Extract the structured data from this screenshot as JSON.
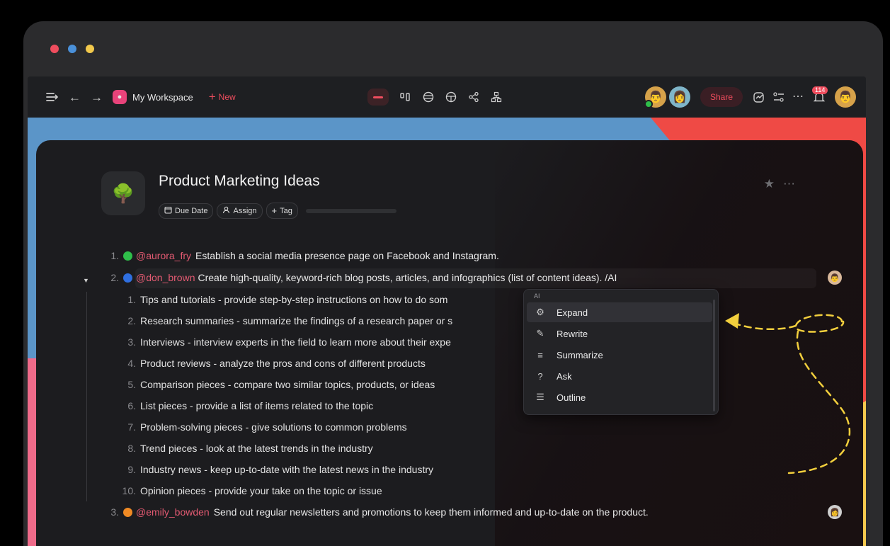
{
  "window": {
    "dot_colors": [
      "#ef4d5e",
      "#4a90d9",
      "#f2c94c"
    ]
  },
  "toolbar": {
    "workspace_name": "My Workspace",
    "new_label": "New",
    "share_label": "Share",
    "notification_count": "114",
    "accent": "#ef4d5e"
  },
  "document": {
    "title": "Product Marketing Ideas",
    "chips": [
      "Due Date",
      "Assign",
      "Tag"
    ],
    "items": [
      {
        "num": "1.",
        "mention": "@aurora_fry",
        "dot_color": "#2fbf4a",
        "text": "Establish a social media presence page on Facebook and Instagram."
      },
      {
        "num": "2.",
        "mention": "@don_brown",
        "dot_color": "#2f6fe0",
        "text": "Create high-quality, keyword-rich blog posts, articles, and infographics (list of content ideas). /AI"
      },
      {
        "num": "3.",
        "mention": "@emily_bowden",
        "dot_color": "#f08a24",
        "text": "Send out regular newsletters and promotions to keep them informed and up-to-date on the product."
      }
    ],
    "sub_items": [
      {
        "num": "1.",
        "text": "Tips and tutorials - provide step-by-step instructions on how to do som"
      },
      {
        "num": "2.",
        "text": "Research summaries - summarize the findings of a research paper or s"
      },
      {
        "num": "3.",
        "text": "Interviews - interview experts in the field to learn more about their expe"
      },
      {
        "num": "4.",
        "text": "Product reviews - analyze the pros and cons of different products"
      },
      {
        "num": "5.",
        "text": "Comparison pieces - compare two similar topics, products, or ideas"
      },
      {
        "num": "6.",
        "text": "List pieces - provide a list of items related to the topic"
      },
      {
        "num": "7.",
        "text": "Problem-solving pieces - give solutions to common problems"
      },
      {
        "num": "8.",
        "text": "Trend pieces - look at the latest trends in the industry"
      },
      {
        "num": "9.",
        "text": "Industry news - keep up-to-date with the latest news in the industry"
      },
      {
        "num": "10.",
        "text": "Opinion pieces - provide your take on the topic or issue"
      }
    ]
  },
  "ai_menu": {
    "header": "AI",
    "items": [
      "Expand",
      "Rewrite",
      "Summarize",
      "Ask",
      "Outline"
    ],
    "active_item": "Expand"
  }
}
